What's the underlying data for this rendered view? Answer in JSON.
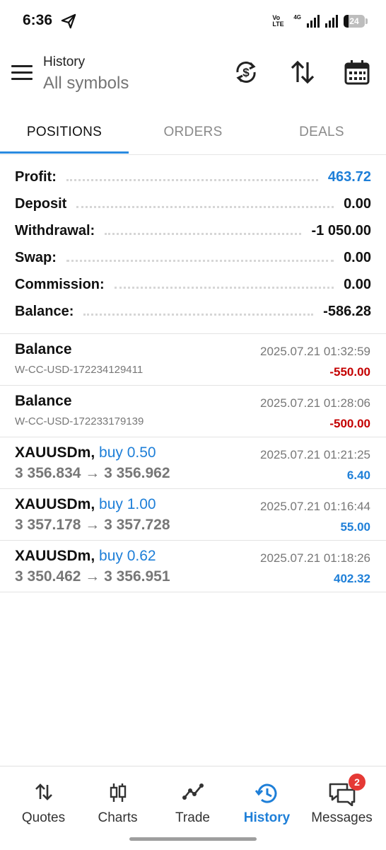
{
  "status_bar": {
    "time": "6:36",
    "volte": "Vo LTE",
    "network": "4G",
    "battery": "24",
    "battery_level": 0.24
  },
  "header": {
    "title": "History",
    "subtitle": "All symbols",
    "icons": [
      "currency-sync-icon",
      "sort-icon",
      "calendar-icon"
    ]
  },
  "tabs": [
    {
      "label": "POSITIONS",
      "active": true
    },
    {
      "label": "ORDERS",
      "active": false
    },
    {
      "label": "DEALS",
      "active": false
    }
  ],
  "summary": [
    {
      "label": "Profit:",
      "value": "463.72",
      "color": "#1e7fd8"
    },
    {
      "label": "Deposit",
      "value": "0.00"
    },
    {
      "label": "Withdrawal:",
      "value": "-1 050.00"
    },
    {
      "label": "Swap:",
      "value": "0.00"
    },
    {
      "label": "Commission:",
      "value": "0.00"
    },
    {
      "label": "Balance:",
      "value": "-586.28"
    }
  ],
  "deals": [
    {
      "title": "Balance",
      "side": "",
      "subtitle": "W-CC-USD-172234129411",
      "time": "2025.07.21 01:32:59",
      "amount": "-550.00",
      "amount_color": "red"
    },
    {
      "title": "Balance",
      "side": "",
      "subtitle": "W-CC-USD-172233179139",
      "time": "2025.07.21 01:28:06",
      "amount": "-500.00",
      "amount_color": "red"
    },
    {
      "title": "XAUUSDm,",
      "side": "buy 0.50",
      "subtitle": "3 356.834 → 3 356.962",
      "time": "2025.07.21 01:21:25",
      "amount": "6.40",
      "amount_color": "blue"
    },
    {
      "title": "XAUUSDm,",
      "side": "buy 1.00",
      "subtitle": "3 357.178 → 3 357.728",
      "time": "2025.07.21 01:16:44",
      "amount": "55.00",
      "amount_color": "blue"
    },
    {
      "title": "XAUUSDm,",
      "side": "buy 0.62",
      "subtitle": "3 350.462 → 3 356.951",
      "time": "2025.07.21 01:18:26",
      "amount": "402.32",
      "amount_color": "blue"
    }
  ],
  "bottom_nav": [
    {
      "label": "Quotes",
      "icon": "quotes-arrows-icon"
    },
    {
      "label": "Charts",
      "icon": "candlestick-icon"
    },
    {
      "label": "Trade",
      "icon": "trade-line-icon"
    },
    {
      "label": "History",
      "icon": "history-clock-icon",
      "active": true
    },
    {
      "label": "Messages",
      "icon": "messages-icon",
      "badge": "2"
    }
  ],
  "colors": {
    "accent": "#1e7fd8",
    "negative": "#c40000"
  }
}
